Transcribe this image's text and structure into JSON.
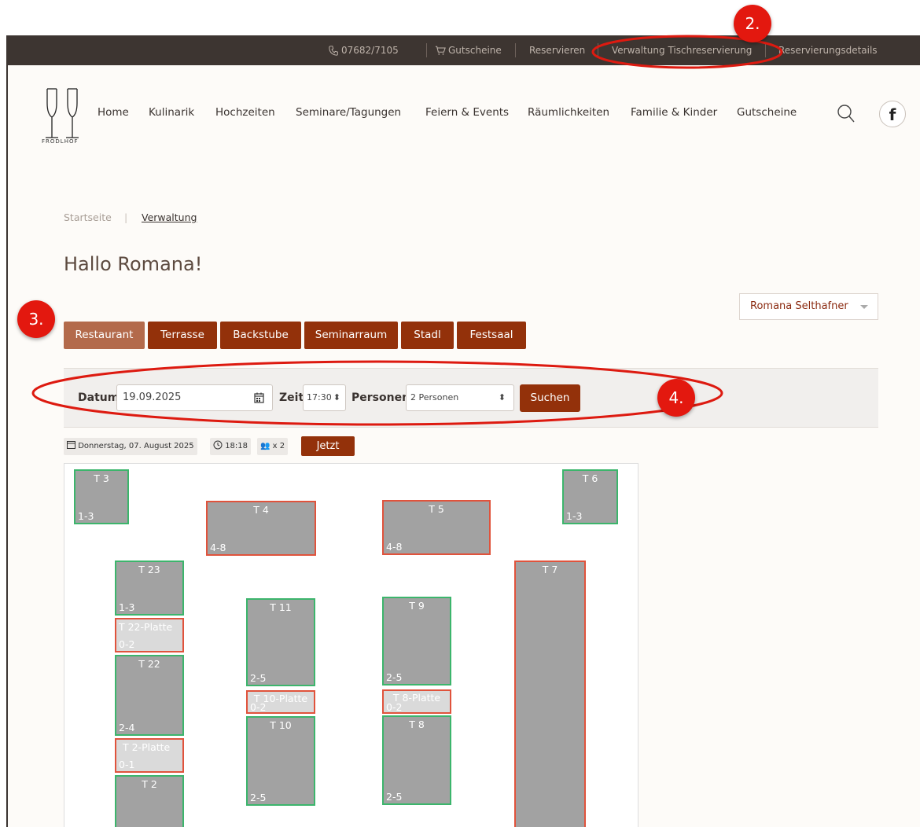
{
  "topbar": {
    "phone": "07682/7105",
    "vouchers": "Gutscheine",
    "reserve": "Reservieren",
    "admin": "Verwaltung Tischreservierung",
    "details": "Reservierungsdetails"
  },
  "logo": {
    "text": "FRODLHOF"
  },
  "nav": [
    "Home",
    "Kulinarik",
    "Hochzeiten",
    "Seminare/Tagungen",
    "Feiern & Events",
    "Räumlichkeiten",
    "Familie & Kinder",
    "Gutscheine"
  ],
  "breadcrumb": {
    "home": "Startseite",
    "current": "Verwaltung"
  },
  "greeting": "Hallo Romana!",
  "user_select": "Romana Selthafner",
  "rooms": [
    "Restaurant",
    "Terrasse",
    "Backstube",
    "Seminarraum",
    "Stadl",
    "Festsaal"
  ],
  "filter": {
    "date_label": "Datum",
    "date_value": "19.09.2025",
    "time_label": "Zeit",
    "time_value": "17:30",
    "persons_label": "Personen",
    "persons_value": "2 Personen",
    "search": "Suchen"
  },
  "info": {
    "date": "Donnerstag, 07. August 2025",
    "time": "18:18",
    "persons": "x 2",
    "now": "Jetzt"
  },
  "tables": [
    {
      "name": "T 3",
      "cap": "1-3",
      "state": "free"
    },
    {
      "name": "T 4",
      "cap": "4-8",
      "state": "taken"
    },
    {
      "name": "T 5",
      "cap": "4-8",
      "state": "taken"
    },
    {
      "name": "T 6",
      "cap": "1-3",
      "state": "free"
    },
    {
      "name": "T 23",
      "cap": "1-3",
      "state": "free"
    },
    {
      "name": "T 22-Platte",
      "cap": "0-2",
      "state": "platte"
    },
    {
      "name": "T 22",
      "cap": "2-4",
      "state": "free"
    },
    {
      "name": "T 2-Platte",
      "cap": "0-1",
      "state": "platte"
    },
    {
      "name": "T 2",
      "cap": "",
      "state": "free"
    },
    {
      "name": "T 11",
      "cap": "2-5",
      "state": "free"
    },
    {
      "name": "T 10-Platte",
      "cap": "0-2",
      "state": "platte"
    },
    {
      "name": "T 10",
      "cap": "2-5",
      "state": "free"
    },
    {
      "name": "T 9",
      "cap": "2-5",
      "state": "free"
    },
    {
      "name": "T 8-Platte",
      "cap": "0-2",
      "state": "platte"
    },
    {
      "name": "T 8",
      "cap": "2-5",
      "state": "free"
    },
    {
      "name": "T 7",
      "cap": "",
      "state": "taken"
    }
  ],
  "annotations": [
    "2.",
    "3.",
    "4."
  ],
  "colors": {
    "brand": "#93310a",
    "active_tab": "#b36a4b",
    "topbar": "#3d3531",
    "free_border": "#3cb56c",
    "taken_border": "#e0533c",
    "badge": "#e3180f"
  }
}
